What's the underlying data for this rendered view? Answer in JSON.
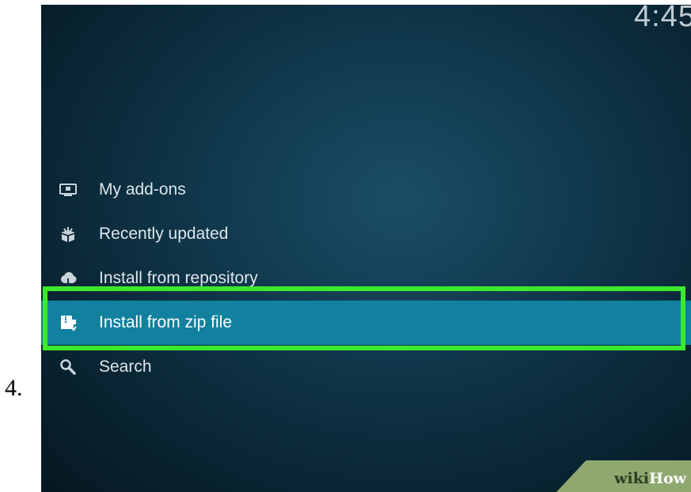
{
  "step": {
    "number": "4."
  },
  "clock": {
    "text": "4:45"
  },
  "menu": {
    "items": [
      {
        "label": "My add-ons",
        "icon": "monitor-icon",
        "selected": false
      },
      {
        "label": "Recently updated",
        "icon": "open-box-icon",
        "selected": false
      },
      {
        "label": "Install from repository",
        "icon": "cloud-download-icon",
        "selected": false
      },
      {
        "label": "Install from zip file",
        "icon": "zip-install-icon",
        "selected": true
      },
      {
        "label": "Search",
        "icon": "search-icon",
        "selected": false
      }
    ]
  },
  "watermark": {
    "wiki": "wiki",
    "how": "How"
  },
  "colors": {
    "background": "#0f3447",
    "selected_row": "#12809f",
    "highlight_border": "#3bea2c",
    "watermark_bg": "#8fa870"
  }
}
